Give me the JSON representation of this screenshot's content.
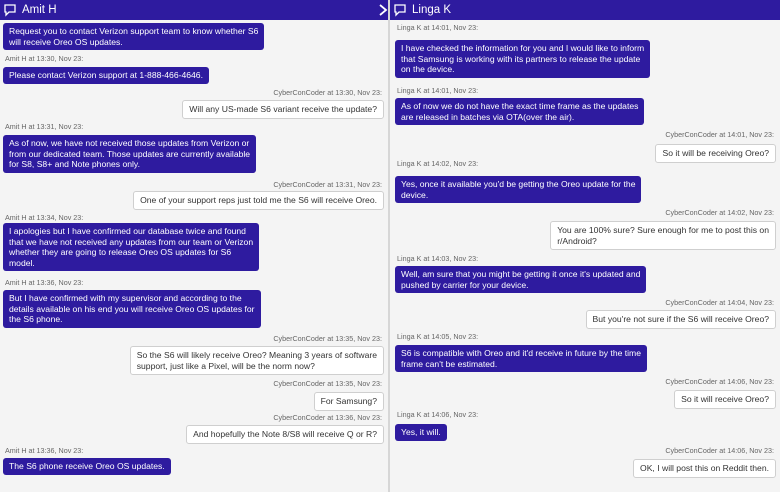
{
  "left": {
    "header": {
      "name": "Amit H",
      "icon": "chat-bubble-icon",
      "chevron": "chevron-right-icon"
    },
    "messages": [
      {
        "kind": "agent",
        "lines": [
          "Request you to contact Verizon support team to know whether S6",
          "will receive Oreo OS updates."
        ]
      },
      {
        "kind": "meta",
        "side": "left",
        "text": "Amit H at 13:30, Nov 23:"
      },
      {
        "kind": "agent",
        "lines": [
          "Please contact Verizon support at 1-888-466-4646."
        ]
      },
      {
        "kind": "meta",
        "side": "right",
        "text": "CyberConCoder at 13:30, Nov 23:"
      },
      {
        "kind": "user",
        "lines": [
          "Will any US-made S6 variant receive the update?"
        ]
      },
      {
        "kind": "meta",
        "side": "left",
        "text": "Amit H at 13:31, Nov 23:"
      },
      {
        "kind": "agent",
        "lines": [
          "As of now, we have not received those updates from Verizon or",
          "from our dedicated team. Those updates are currently available",
          "for S8, S8+ and Note phones only."
        ]
      },
      {
        "kind": "meta",
        "side": "right",
        "text": "CyberConCoder at 13:31, Nov 23:"
      },
      {
        "kind": "user",
        "lines": [
          "One of your support reps just told me the S6 will receive Oreo."
        ]
      },
      {
        "kind": "meta",
        "side": "left",
        "text": "Amit H at 13:34, Nov 23:"
      },
      {
        "kind": "agent",
        "lines": [
          "I apologies but I have confirmed our database twice and found",
          "that we have not received any updates from our team or Verizon",
          "whether they are going to release Oreo OS updates for S6",
          "model."
        ]
      },
      {
        "kind": "meta",
        "side": "left",
        "text": "Amit H at 13:36, Nov 23:"
      },
      {
        "kind": "agent",
        "lines": [
          "But I have confirmed with my supervisor and according to the",
          "details available on his end you will receive Oreo OS updates for",
          "the S6 phone."
        ]
      },
      {
        "kind": "meta",
        "side": "right",
        "text": "CyberConCoder at 13:35, Nov 23:"
      },
      {
        "kind": "user",
        "lines": [
          "So the S6 will likely receive Oreo? Meaning 3 years of software",
          "support, just like a Pixel, will be the norm now?"
        ]
      },
      {
        "kind": "meta",
        "side": "right",
        "text": "CyberConCoder at 13:35, Nov 23:"
      },
      {
        "kind": "user",
        "lines": [
          "For Samsung?"
        ]
      },
      {
        "kind": "meta",
        "side": "right",
        "text": "CyberConCoder at 13:36, Nov 23:"
      },
      {
        "kind": "user",
        "lines": [
          "And hopefully the Note 8/S8 will receive Q or R?"
        ]
      },
      {
        "kind": "meta",
        "side": "left",
        "text": "Amit H at 13:36, Nov 23:"
      },
      {
        "kind": "agent",
        "lines": [
          "The S6 phone receive Oreo OS updates."
        ]
      }
    ]
  },
  "right": {
    "header": {
      "name": "Linga K",
      "icon": "chat-bubble-icon",
      "chevron": "chevron-right-icon"
    },
    "messages": [
      {
        "kind": "meta",
        "side": "left",
        "text": "Linga K at 14:01, Nov 23:"
      },
      {
        "kind": "agent",
        "lines": [
          "I have checked the information for you and I would like to inform",
          "that Samsung is working with its partners to release the update",
          "on the device."
        ]
      },
      {
        "kind": "meta",
        "side": "left",
        "text": "Linga K at 14:01, Nov 23:"
      },
      {
        "kind": "agent",
        "lines": [
          "As of now we do not have the exact time frame as the updates",
          "are released in batches via OTA(over the air)."
        ]
      },
      {
        "kind": "meta",
        "side": "right",
        "text": "CyberConCoder at 14:01, Nov 23:"
      },
      {
        "kind": "user",
        "lines": [
          "So it will be receiving Oreo?"
        ]
      },
      {
        "kind": "meta",
        "side": "left",
        "text": "Linga K at 14:02, Nov 23:"
      },
      {
        "kind": "agent",
        "lines": [
          "Yes, once it available you'd be getting the Oreo update for the",
          "device."
        ]
      },
      {
        "kind": "meta",
        "side": "right",
        "text": "CyberConCoder at 14:02, Nov 23:"
      },
      {
        "kind": "user",
        "lines": [
          "You are 100% sure? Sure enough for me to post this on",
          "r/Android?"
        ]
      },
      {
        "kind": "meta",
        "side": "left",
        "text": "Linga K at 14:03, Nov 23:"
      },
      {
        "kind": "agent",
        "lines": [
          "Well, am sure that you might be getting it once it's updated and",
          "pushed by carrier for your device."
        ]
      },
      {
        "kind": "meta",
        "side": "right",
        "text": "CyberConCoder at 14:04, Nov 23:"
      },
      {
        "kind": "user",
        "lines": [
          "But you're not sure if the S6 will receive Oreo?"
        ]
      },
      {
        "kind": "meta",
        "side": "left",
        "text": "Linga K at 14:05, Nov 23:"
      },
      {
        "kind": "agent",
        "lines": [
          "S6 is compatible with Oreo and it'd receive in future by the time",
          "frame can't be estimated."
        ]
      },
      {
        "kind": "meta",
        "side": "right",
        "text": "CyberConCoder at 14:06, Nov 23:"
      },
      {
        "kind": "user",
        "lines": [
          "So it will receive Oreo?"
        ]
      },
      {
        "kind": "meta",
        "side": "left",
        "text": "Linga K at 14:06, Nov 23:"
      },
      {
        "kind": "agent",
        "lines": [
          "Yes, it will."
        ]
      },
      {
        "kind": "meta",
        "side": "right",
        "text": "CyberConCoder at 14:06, Nov 23:"
      },
      {
        "kind": "user",
        "lines": [
          "OK, I will post this on Reddit then."
        ]
      }
    ]
  },
  "colors": {
    "agent_bubble": "#2e1b9f",
    "header": "#2e1b9f",
    "user_bubble": "#ffffff",
    "background": "#f4f4f4"
  }
}
